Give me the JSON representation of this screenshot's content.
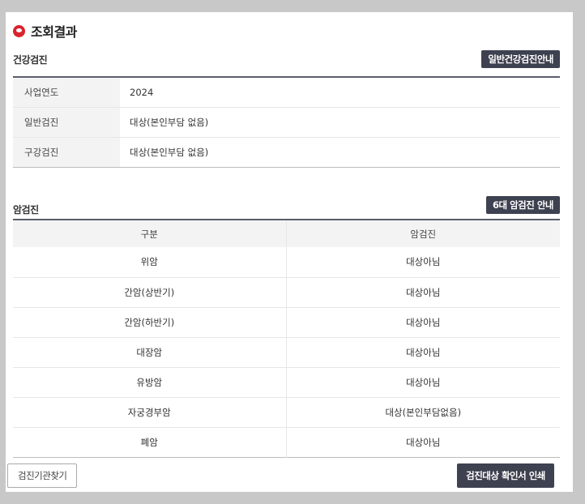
{
  "page": {
    "title": "조회결과"
  },
  "health": {
    "label": "건강검진",
    "guide_button": "일반건강검진안내",
    "rows": [
      {
        "label": "사업연도",
        "value": "2024"
      },
      {
        "label": "일반검진",
        "value": "대상(본인부담 없음)"
      },
      {
        "label": "구강검진",
        "value": "대상(본인부담 없음)"
      }
    ]
  },
  "cancer": {
    "label": "암검진",
    "guide_button": "6대 암검진 안내",
    "headers": [
      "구분",
      "암검진"
    ],
    "rows": [
      {
        "type": "위암",
        "status": "대상아님"
      },
      {
        "type": "간암(상반기)",
        "status": "대상아님"
      },
      {
        "type": "간암(하반기)",
        "status": "대상아님"
      },
      {
        "type": "대장암",
        "status": "대상아님"
      },
      {
        "type": "유방암",
        "status": "대상아님"
      },
      {
        "type": "자궁경부암",
        "status": "대상(본인부담없음)"
      },
      {
        "type": "폐암",
        "status": "대상아님"
      }
    ]
  },
  "footer": {
    "find_button": "검진기관찾기",
    "print_button": "검진대상 확인서 인쇄"
  }
}
